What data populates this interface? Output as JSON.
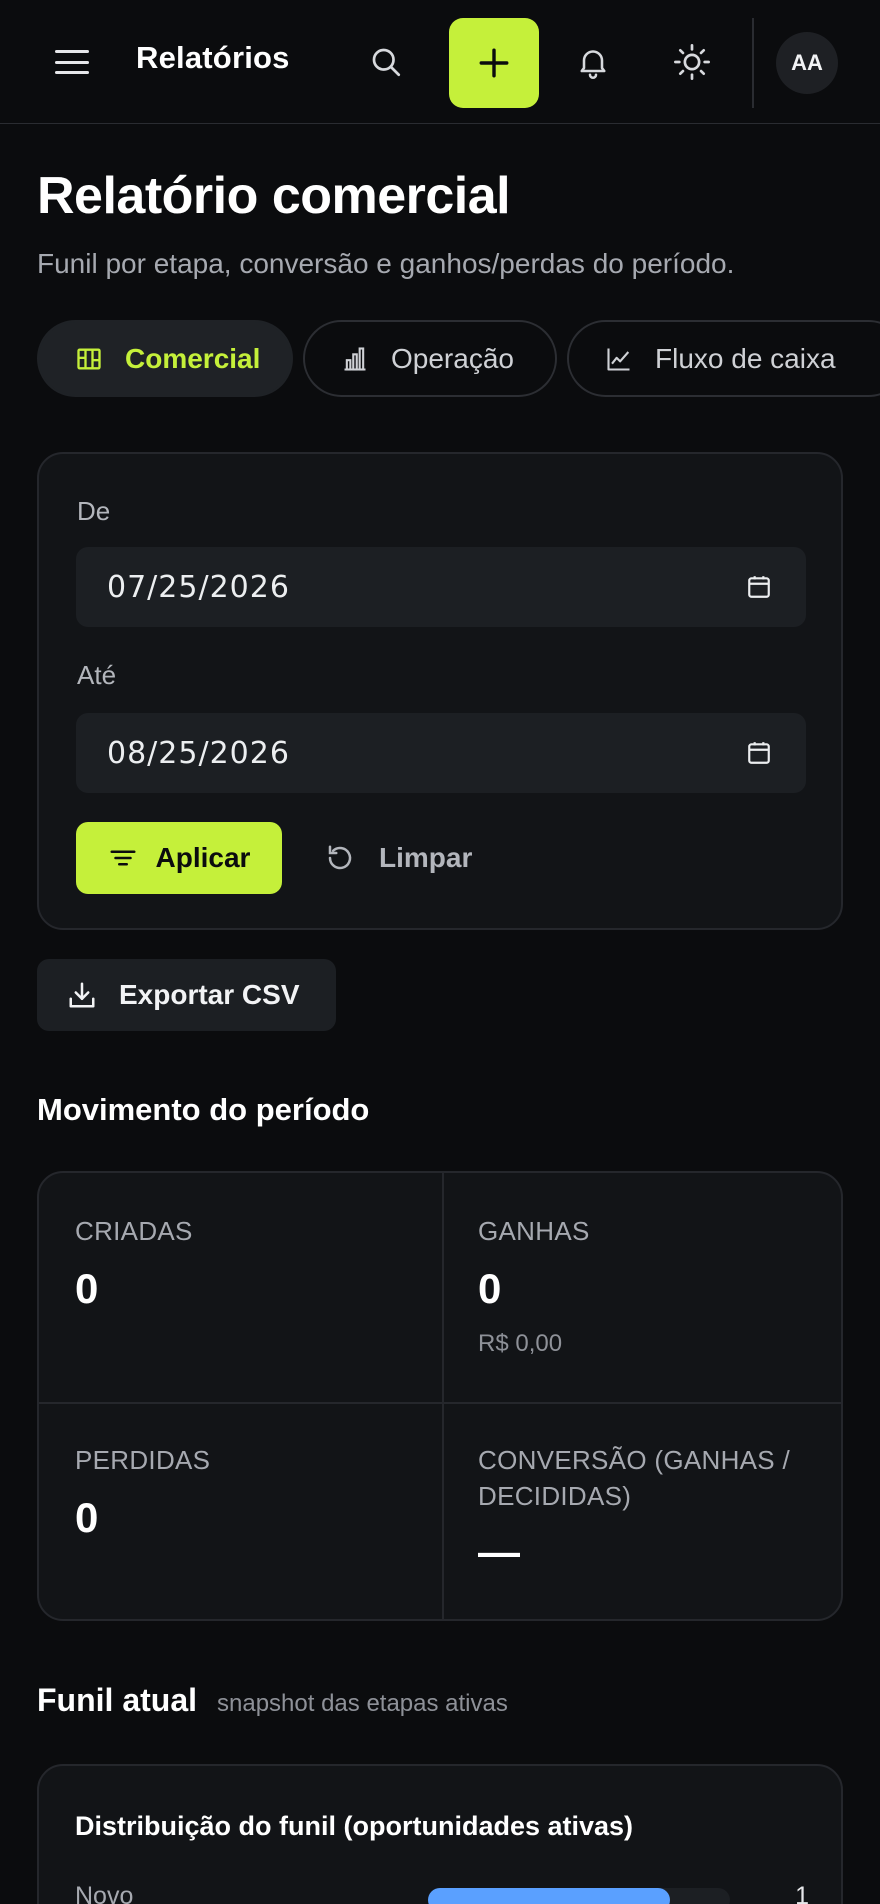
{
  "header": {
    "title": "Relatórios",
    "avatar_initials": "AA",
    "accent_color": "#c5f03a"
  },
  "page": {
    "title": "Relatório comercial",
    "subtitle": "Funil por etapa, conversão e ganhos/perdas do período."
  },
  "tabs": [
    {
      "label": "Comercial",
      "icon": "kanban-icon",
      "active": true
    },
    {
      "label": "Operação",
      "icon": "bar-chart-icon",
      "active": false
    },
    {
      "label": "Fluxo de caixa",
      "icon": "line-chart-icon",
      "active": false
    }
  ],
  "filters": {
    "from_label": "De",
    "from_value": "07/25/2026",
    "to_label": "Até",
    "to_value": "08/25/2026",
    "apply_label": "Aplicar",
    "clear_label": "Limpar"
  },
  "export": {
    "label": "Exportar CSV"
  },
  "movement": {
    "title": "Movimento do período",
    "metrics": [
      {
        "label": "CRIADAS",
        "value": "0",
        "sub": ""
      },
      {
        "label": "GANHAS",
        "value": "0",
        "sub": "R$ 0,00"
      },
      {
        "label": "PERDIDAS",
        "value": "0",
        "sub": ""
      },
      {
        "label": "CONVERSÃO (GANHAS / DECIDIDAS)",
        "value": "—",
        "sub": ""
      }
    ]
  },
  "funnel": {
    "title": "Funil atual",
    "subtitle": "snapshot das etapas ativas",
    "card_title": "Distribuição do funil (oportunidades ativas)",
    "rows": [
      {
        "label": "Novo",
        "count": "1",
        "fill": 0.8,
        "color": "#5aa0ff"
      }
    ]
  }
}
